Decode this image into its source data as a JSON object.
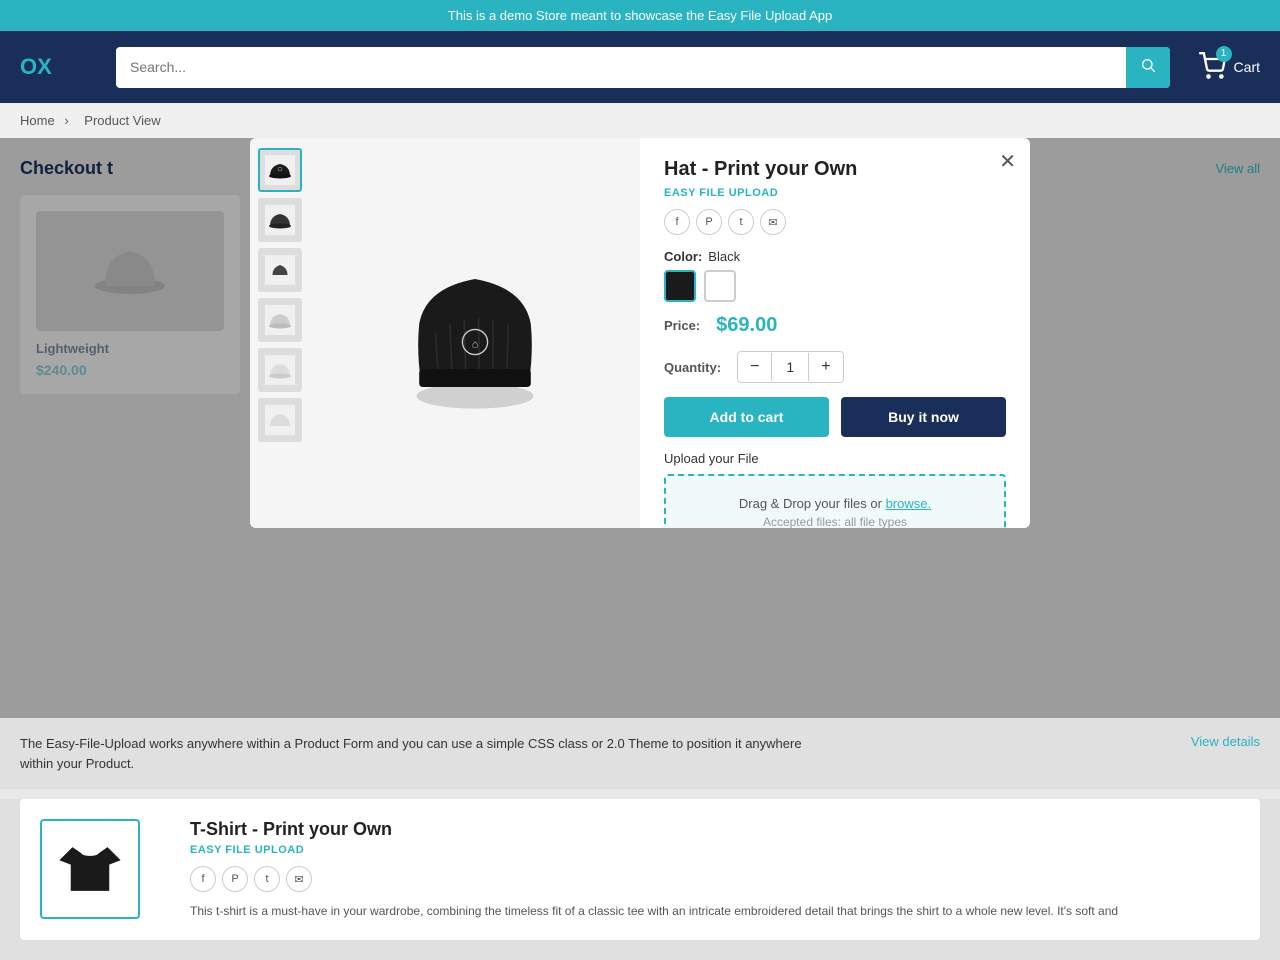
{
  "announcement": {
    "text": "This is a demo Store meant to showcase the Easy File Upload App"
  },
  "header": {
    "logo": "OX",
    "search_placeholder": "Search...",
    "cart_label": "Cart",
    "cart_count": "1"
  },
  "breadcrumb": {
    "home": "Home",
    "current": "Product View"
  },
  "page": {
    "checkout_title": "Checkout t",
    "view_all": "View all"
  },
  "background_product": {
    "name": "Lightweight",
    "price": "$240.00"
  },
  "modal": {
    "title": "Hat - Print your Own",
    "easy_file_label": "EASY FILE UPLOAD",
    "color_label": "Color:",
    "color_value": "Black",
    "price_label": "Price:",
    "price_value": "$69.00",
    "quantity_label": "Quantity:",
    "quantity_value": "1",
    "add_to_cart_label": "Add to cart",
    "buy_now_label": "Buy it now",
    "upload_label": "Upload your File",
    "drag_drop_text": "Drag & Drop your files or",
    "browse_text": "browse.",
    "accepted_text": "Accepted files: all file types",
    "colors": [
      {
        "name": "Black",
        "value": "black",
        "selected": true
      },
      {
        "name": "White",
        "value": "white",
        "selected": false
      }
    ],
    "thumbnails": [
      {
        "id": 1,
        "active": true
      },
      {
        "id": 2,
        "active": false
      },
      {
        "id": 3,
        "active": false
      },
      {
        "id": 4,
        "active": false
      },
      {
        "id": 5,
        "active": false
      },
      {
        "id": 6,
        "active": false
      }
    ]
  },
  "description": {
    "text": "The Easy-File-Upload works anywhere within a Product Form and you can use a simple CSS class or 2.0 Theme to position it anywhere within your Product.",
    "view_details": "View details"
  },
  "second_product": {
    "title": "T-Shirt - Print your Own",
    "easy_file_label": "EASY FILE UPLOAD",
    "description": "This t-shirt is a must-have in your wardrobe, combining the timeless fit of a classic tee with an intricate embroidered detail that brings the shirt to a whole new level. It's soft and"
  }
}
